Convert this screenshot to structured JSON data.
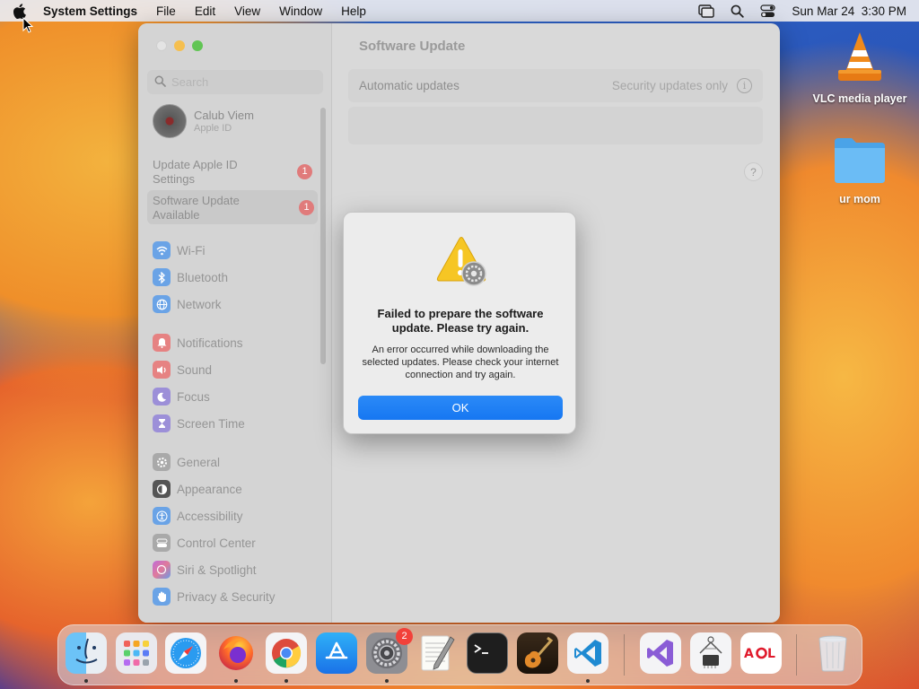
{
  "menubar": {
    "app_name": "System Settings",
    "menus": [
      "File",
      "Edit",
      "View",
      "Window",
      "Help"
    ],
    "datetime": "Sun Mar 24  3:30 PM"
  },
  "desktop": {
    "icons": [
      {
        "label": "VLC media player",
        "icon": "vlc-cone-icon"
      },
      {
        "label": "ur mom",
        "icon": "folder-icon"
      }
    ]
  },
  "window": {
    "title": "Software Update",
    "search_placeholder": "Search",
    "profile": {
      "name": "Calub Viem",
      "subtitle": "Apple ID"
    },
    "notices": [
      {
        "label": "Update Apple ID Settings",
        "badge": "1"
      },
      {
        "label": "Software Update Available",
        "badge": "1"
      }
    ],
    "sidebar_groups": [
      [
        "Wi-Fi",
        "Bluetooth",
        "Network"
      ],
      [
        "Notifications",
        "Sound",
        "Focus",
        "Screen Time"
      ],
      [
        "General",
        "Appearance",
        "Accessibility",
        "Control Center",
        "Siri & Spotlight",
        "Privacy & Security"
      ]
    ],
    "auto_updates_label": "Automatic updates",
    "auto_updates_value": "Security updates only",
    "help_label": "?"
  },
  "dialog": {
    "title": "Failed to prepare the software update. Please try again.",
    "message": "An error occurred while downloading the selected updates. Please check your internet connection and try again.",
    "ok_label": "OK"
  },
  "dock": {
    "system_settings_badge": "2",
    "apps": [
      "Finder",
      "Launchpad",
      "Safari",
      "Firefox",
      "Chrome",
      "App Store",
      "System Settings",
      "TextEdit",
      "Terminal",
      "GarageBand",
      "Visual Studio Code",
      "Visual Studio",
      "System Information",
      "AOL",
      "Trash"
    ]
  },
  "colors": {
    "accent_blue": "#1677f2",
    "badge_red": "#f2413a",
    "sidebar_badge": "#e07b7b"
  }
}
